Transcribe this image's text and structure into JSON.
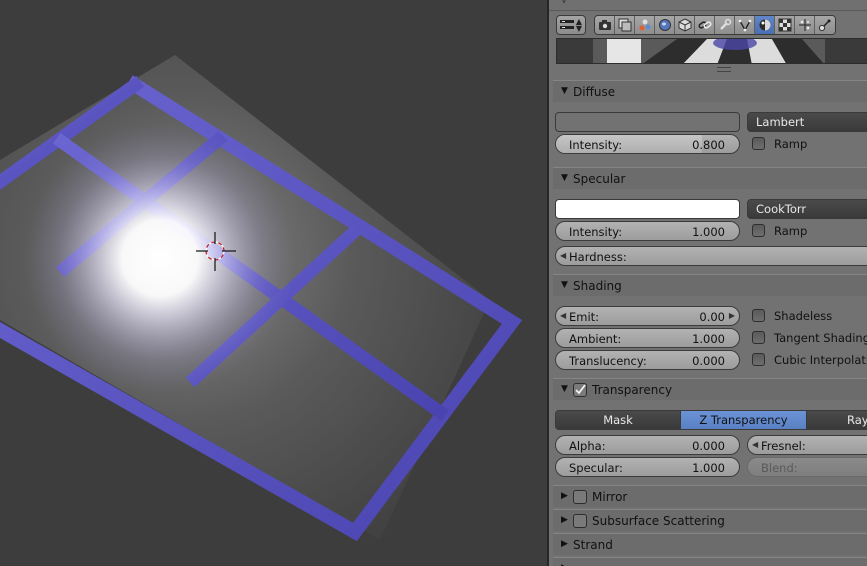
{
  "properties_editor": {
    "top_hint": "∇",
    "context_tabs": [
      {
        "name": "render-tab",
        "icon": "camera-icon",
        "active": false
      },
      {
        "name": "render-layers-tab",
        "icon": "layers-icon",
        "active": false
      },
      {
        "name": "scene-tab",
        "icon": "scene-icon",
        "active": false
      },
      {
        "name": "world-tab",
        "icon": "world-icon",
        "active": false
      },
      {
        "name": "object-tab",
        "icon": "cube-icon",
        "active": false
      },
      {
        "name": "constraints-tab",
        "icon": "link-icon",
        "active": false
      },
      {
        "name": "modifiers-tab",
        "icon": "wrench-icon",
        "active": false
      },
      {
        "name": "data-tab",
        "icon": "mesh-icon",
        "active": false
      },
      {
        "name": "material-tab",
        "icon": "material-sphere-icon",
        "active": true
      },
      {
        "name": "texture-tab",
        "icon": "checker-icon",
        "active": false
      },
      {
        "name": "particles-tab",
        "icon": "particles-icon",
        "active": false
      },
      {
        "name": "physics-tab",
        "icon": "physics-icon",
        "active": false
      }
    ],
    "diffuse": {
      "title": "Diffuse",
      "color": "#727272",
      "shader": "Lambert",
      "intensity_label": "Intensity:",
      "intensity_value": "0.800",
      "intensity_fraction": 0.8,
      "ramp_label": "Ramp"
    },
    "specular": {
      "title": "Specular",
      "color": "#ffffff",
      "shader": "CookTorr",
      "intensity_label": "Intensity:",
      "intensity_value": "1.000",
      "ramp_label": "Ramp",
      "hardness_label": "Hardness:"
    },
    "shading": {
      "title": "Shading",
      "emit_label": "Emit:",
      "emit_value": "0.00",
      "ambient_label": "Ambient:",
      "ambient_value": "1.000",
      "translucency_label": "Translucency:",
      "translucency_value": "0.000",
      "shadeless_label": "Shadeless",
      "tangent_label": "Tangent Shading",
      "cubic_label": "Cubic Interpolation"
    },
    "transparency": {
      "title": "Transparency",
      "enabled": true,
      "modes": [
        "Mask",
        "Z Transparency",
        "Rayt"
      ],
      "active_mode": "Z Transparency",
      "alpha_label": "Alpha:",
      "alpha_value": "0.000",
      "fresnel_label": "Fresnel:",
      "specular_label": "Specular:",
      "specular_value": "1.000",
      "blend_label": "Blend:"
    },
    "mirror": {
      "title": "Mirror"
    },
    "sss": {
      "title": "Subsurface Scattering"
    },
    "strand": {
      "title": "Strand"
    }
  },
  "colors": {
    "accent": "#5680c2",
    "grid_blue": "#4a46a8",
    "panel_bg": "#727272"
  }
}
